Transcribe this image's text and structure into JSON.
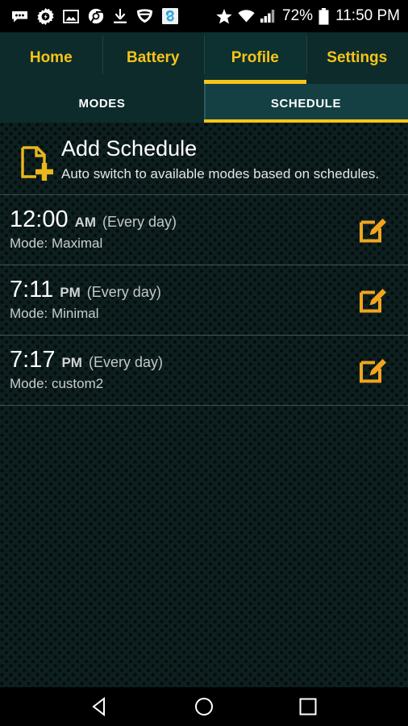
{
  "statusbar": {
    "left_icons": [
      {
        "name": "messages-icon"
      },
      {
        "name": "settings-gear-icon"
      },
      {
        "name": "gallery-image-icon"
      },
      {
        "name": "chrome-browser-icon"
      },
      {
        "name": "download-icon"
      },
      {
        "name": "vpn-shield-icon"
      },
      {
        "name": "app-badge-icon"
      }
    ],
    "right_icons": [
      {
        "name": "star-icon"
      },
      {
        "name": "wifi-icon"
      },
      {
        "name": "cellular-signal-icon"
      }
    ],
    "battery_percent": "72%",
    "battery_icon": "battery-full-icon",
    "clock": "11:50 PM"
  },
  "tabs": [
    {
      "label": "Home",
      "active": false
    },
    {
      "label": "Battery",
      "active": false
    },
    {
      "label": "Profile",
      "active": true
    },
    {
      "label": "Settings",
      "active": false
    }
  ],
  "subtabs": [
    {
      "label": "MODES",
      "active": false
    },
    {
      "label": "SCHEDULE",
      "active": true
    }
  ],
  "add_schedule": {
    "icon": "add-document-icon",
    "title": "Add Schedule",
    "subtitle": "Auto switch to available modes based on schedules."
  },
  "schedules": [
    {
      "time": "12:00",
      "meridiem": "AM",
      "repeat": "(Every day)",
      "mode": "Mode: Maximal",
      "edit_icon": "edit-pencil-icon"
    },
    {
      "time": "7:11",
      "meridiem": "PM",
      "repeat": "(Every day)",
      "mode": "Mode: Minimal",
      "edit_icon": "edit-pencil-icon"
    },
    {
      "time": "7:17",
      "meridiem": "PM",
      "repeat": "(Every day)",
      "mode": "Mode: custom2",
      "edit_icon": "edit-pencil-icon"
    }
  ],
  "navbar": [
    {
      "name": "back-button"
    },
    {
      "name": "home-button"
    },
    {
      "name": "recents-button"
    }
  ],
  "colors": {
    "accent": "#f5c518",
    "tabbar_bg": "#0d2b2b",
    "subtab_active_bg": "#144044",
    "content_bg": "#0e1f1f",
    "text_primary": "#ffffff",
    "text_secondary": "#c8cecd"
  }
}
